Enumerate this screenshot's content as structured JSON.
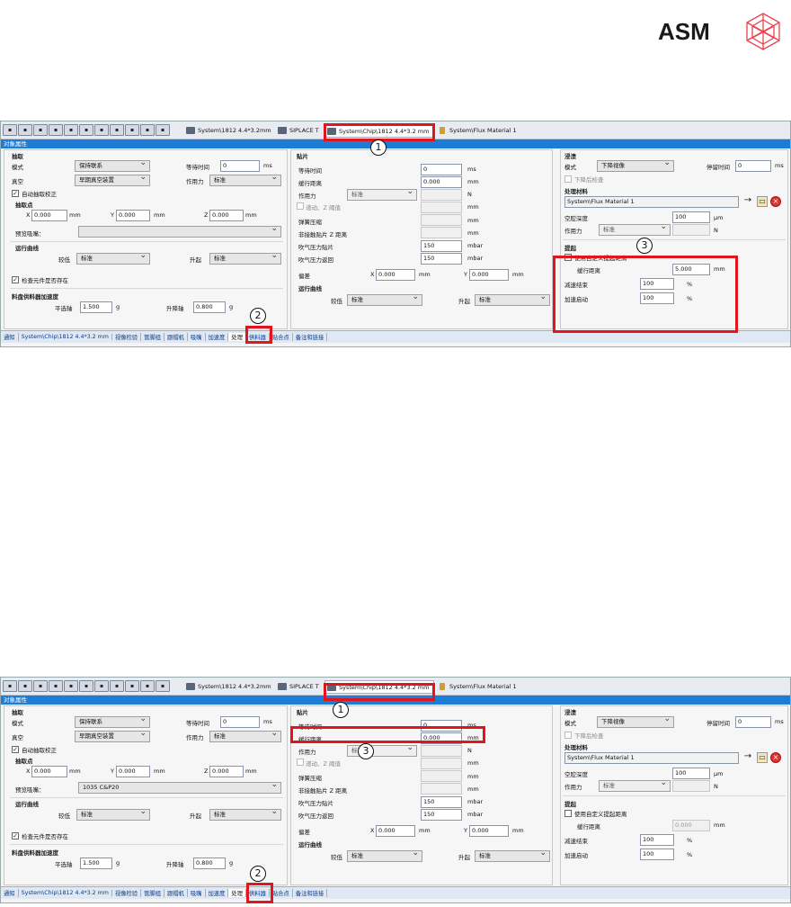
{
  "brand": {
    "name": "ASM"
  },
  "toolbar_icons": [
    "ok-icon",
    "copy-icon",
    "move-icon",
    "tool-icon",
    "pc-icon",
    "panel-icon",
    "table-icon",
    "layout-icon",
    "book-icon",
    "stop-icon",
    "grid-icon"
  ],
  "shots": [
    {
      "tabs": {
        "tab1": "System\\1812 4.4*3.2mm",
        "tab2": "SIPLACE T",
        "tab3": "System\\Chip\\1812 4.4*3.2 mm",
        "tab4": "System\\Flux Material 1"
      },
      "title": "对象属性",
      "pick": {
        "group": "抽取",
        "mode_label": "模式",
        "mode_value": "保持联系",
        "wait_label": "等待时间",
        "wait_value": "0",
        "wait_unit": "ms",
        "vacuum_label": "真空",
        "vacuum_value": "早期真空装置",
        "force_label": "作用力",
        "force_value": "标准",
        "autocorr_label": "自动抽取校正",
        "pickpoint_group": "抽取点",
        "x_label": "X",
        "x_value": "0.000",
        "x_unit": "mm",
        "y_label": "Y",
        "y_value": "0.000",
        "y_unit": "mm",
        "z_label": "Z",
        "z_value": "0.000",
        "z_unit": "mm",
        "nozzle_label": "预览吸嘴：",
        "nozzle_value": "",
        "curve_group": "运行曲线",
        "lower_label": "较低",
        "lower_value": "标准",
        "raise_label": "升起",
        "raise_value": "标准",
        "check_label": "检查元件是否存在",
        "accel_group": "料盘供料器加速度",
        "sel_axis_label": "平选轴",
        "sel_axis_value": "1.500",
        "sel_axis_unit": "g",
        "lift_axis_label": "升降轴",
        "lift_axis_value": "0.800",
        "lift_axis_unit": "g"
      },
      "place": {
        "group": "贴片",
        "wait_label": "等待时间",
        "wait_value": "0",
        "wait_unit": "ms",
        "slow_label": "缓行距离",
        "slow_value": "0.000",
        "slow_unit": "mm",
        "force_label": "作用力",
        "force_value": "标准",
        "force_unit": "N",
        "z_label": "递动、Z 阈值",
        "z_unit": "mm",
        "spring_label": "弹簧压缩",
        "spring_unit": "mm",
        "noncontact_label": "非接触贴片 Z 距离",
        "noncontact_unit": "mm",
        "blow_place_label": "吹气压力贴片",
        "blow_place_value": "150",
        "blow_place_unit": "mbar",
        "blow_return_label": "吹气压力返回",
        "blow_return_value": "150",
        "blow_return_unit": "mbar",
        "offset_label": "偏差",
        "offx_label": "X",
        "offx_value": "0.000",
        "offx_unit": "mm",
        "offy_label": "Y",
        "offy_value": "0.000",
        "offy_unit": "mm",
        "curve_group": "运行曲线",
        "lower_label": "较低",
        "lower_value": "标准",
        "raise_label": "升起",
        "raise_value": "标准"
      },
      "dip": {
        "group": "浸渍",
        "mode_label": "模式",
        "mode_value": "下降视像",
        "dwell_label": "停留时间",
        "dwell_value": "0",
        "dwell_unit": "ms",
        "after_label": "下降后检查",
        "material_group": "处理材料",
        "material_value": "System\\Flux Material 1",
        "depth_label": "空腔深度",
        "depth_value": "100",
        "depth_unit": "μm",
        "force_label": "作用力",
        "force_value": "标准",
        "force_unit": "N",
        "lift_group": "提起",
        "custom_label": "使用自定义提起距离",
        "slow_label": "缓行距离",
        "slow_value": "5.000",
        "slow_unit": "mm",
        "dec_label": "减速结束",
        "dec_value": "100",
        "dec_unit": "%",
        "acc_label": "加速启动",
        "acc_value": "100",
        "acc_unit": "%"
      },
      "statusbar": [
        "通知",
        "System\\Chip\\1812 4.4*3.2 mm",
        "视像检验",
        "管脚组",
        "跟帽机",
        "吸嘴",
        "加速度",
        "处理",
        "供料器",
        "贴合点",
        "备注和链接"
      ],
      "callouts": [
        "1",
        "2",
        "3"
      ]
    },
    {
      "tabs": {
        "tab1": "System\\1812 4.4*3.2mm",
        "tab2": "SIPLACE T",
        "tab3": "System\\Chip\\1812 4.4*3.2 mm",
        "tab4": "System\\Flux Material 1"
      },
      "title": "对象属性",
      "pick": {
        "group": "抽取",
        "mode_label": "模式",
        "mode_value": "保持联系",
        "wait_label": "等待时间",
        "wait_value": "0",
        "wait_unit": "ms",
        "vacuum_label": "真空",
        "vacuum_value": "早期真空装置",
        "force_label": "作用力",
        "force_value": "标准",
        "autocorr_label": "自动抽取校正",
        "pickpoint_group": "抽取点",
        "x_label": "X",
        "x_value": "0.000",
        "x_unit": "mm",
        "y_label": "Y",
        "y_value": "0.000",
        "y_unit": "mm",
        "z_label": "Z",
        "z_value": "0.000",
        "z_unit": "mm",
        "nozzle_label": "预览吸嘴：",
        "nozzle_value": "1035 C&P20",
        "curve_group": "运行曲线",
        "lower_label": "较低",
        "lower_value": "标准",
        "raise_label": "升起",
        "raise_value": "标准",
        "check_label": "检查元件是否存在",
        "accel_group": "料盘供料器加速度",
        "sel_axis_label": "平选轴",
        "sel_axis_value": "1.500",
        "sel_axis_unit": "g",
        "lift_axis_label": "升降轴",
        "lift_axis_value": "0.800",
        "lift_axis_unit": "g"
      },
      "place": {
        "group": "贴片",
        "wait_label": "等待时间",
        "wait_value": "0",
        "wait_unit": "ms",
        "slow_label": "缓行距离",
        "slow_value": "0.000",
        "slow_unit": "mm",
        "force_label": "作用力",
        "force_value": "标准",
        "force_unit": "N",
        "z_label": "递动、Z 阈值",
        "z_unit": "mm",
        "spring_label": "弹簧压缩",
        "spring_unit": "mm",
        "noncontact_label": "非接触贴片 Z 距离",
        "noncontact_unit": "mm",
        "blow_place_label": "吹气压力贴片",
        "blow_place_value": "150",
        "blow_place_unit": "mbar",
        "blow_return_label": "吹气压力返回",
        "blow_return_value": "150",
        "blow_return_unit": "mbar",
        "offset_label": "偏差",
        "offx_label": "X",
        "offx_value": "0.000",
        "offx_unit": "mm",
        "offy_label": "Y",
        "offy_value": "0.000",
        "offy_unit": "mm",
        "curve_group": "运行曲线",
        "lower_label": "较低",
        "lower_value": "标准",
        "raise_label": "升起",
        "raise_value": "标准"
      },
      "dip": {
        "group": "浸渍",
        "mode_label": "模式",
        "mode_value": "下降视像",
        "dwell_label": "停留时间",
        "dwell_value": "0",
        "dwell_unit": "ms",
        "after_label": "下降后检查",
        "material_group": "处理材料",
        "material_value": "System\\Flux Material 1",
        "depth_label": "空腔深度",
        "depth_value": "100",
        "depth_unit": "μm",
        "force_label": "作用力",
        "force_value": "标准",
        "force_unit": "N",
        "lift_group": "提起",
        "custom_label": "使用自定义提起距离",
        "slow_label": "缓行距离",
        "slow_value": "0.000",
        "slow_unit": "mm",
        "dec_label": "减速结束",
        "dec_value": "100",
        "dec_unit": "%",
        "acc_label": "加速启动",
        "acc_value": "100",
        "acc_unit": "%"
      },
      "statusbar": [
        "通知",
        "System\\Chip\\1812 4.4*3.2 mm",
        "视像检验",
        "管脚组",
        "跟帽机",
        "吸嘴",
        "加速度",
        "处理",
        "供料器",
        "贴合点",
        "备注和链接"
      ],
      "callouts": [
        "1",
        "2",
        "3"
      ]
    }
  ]
}
